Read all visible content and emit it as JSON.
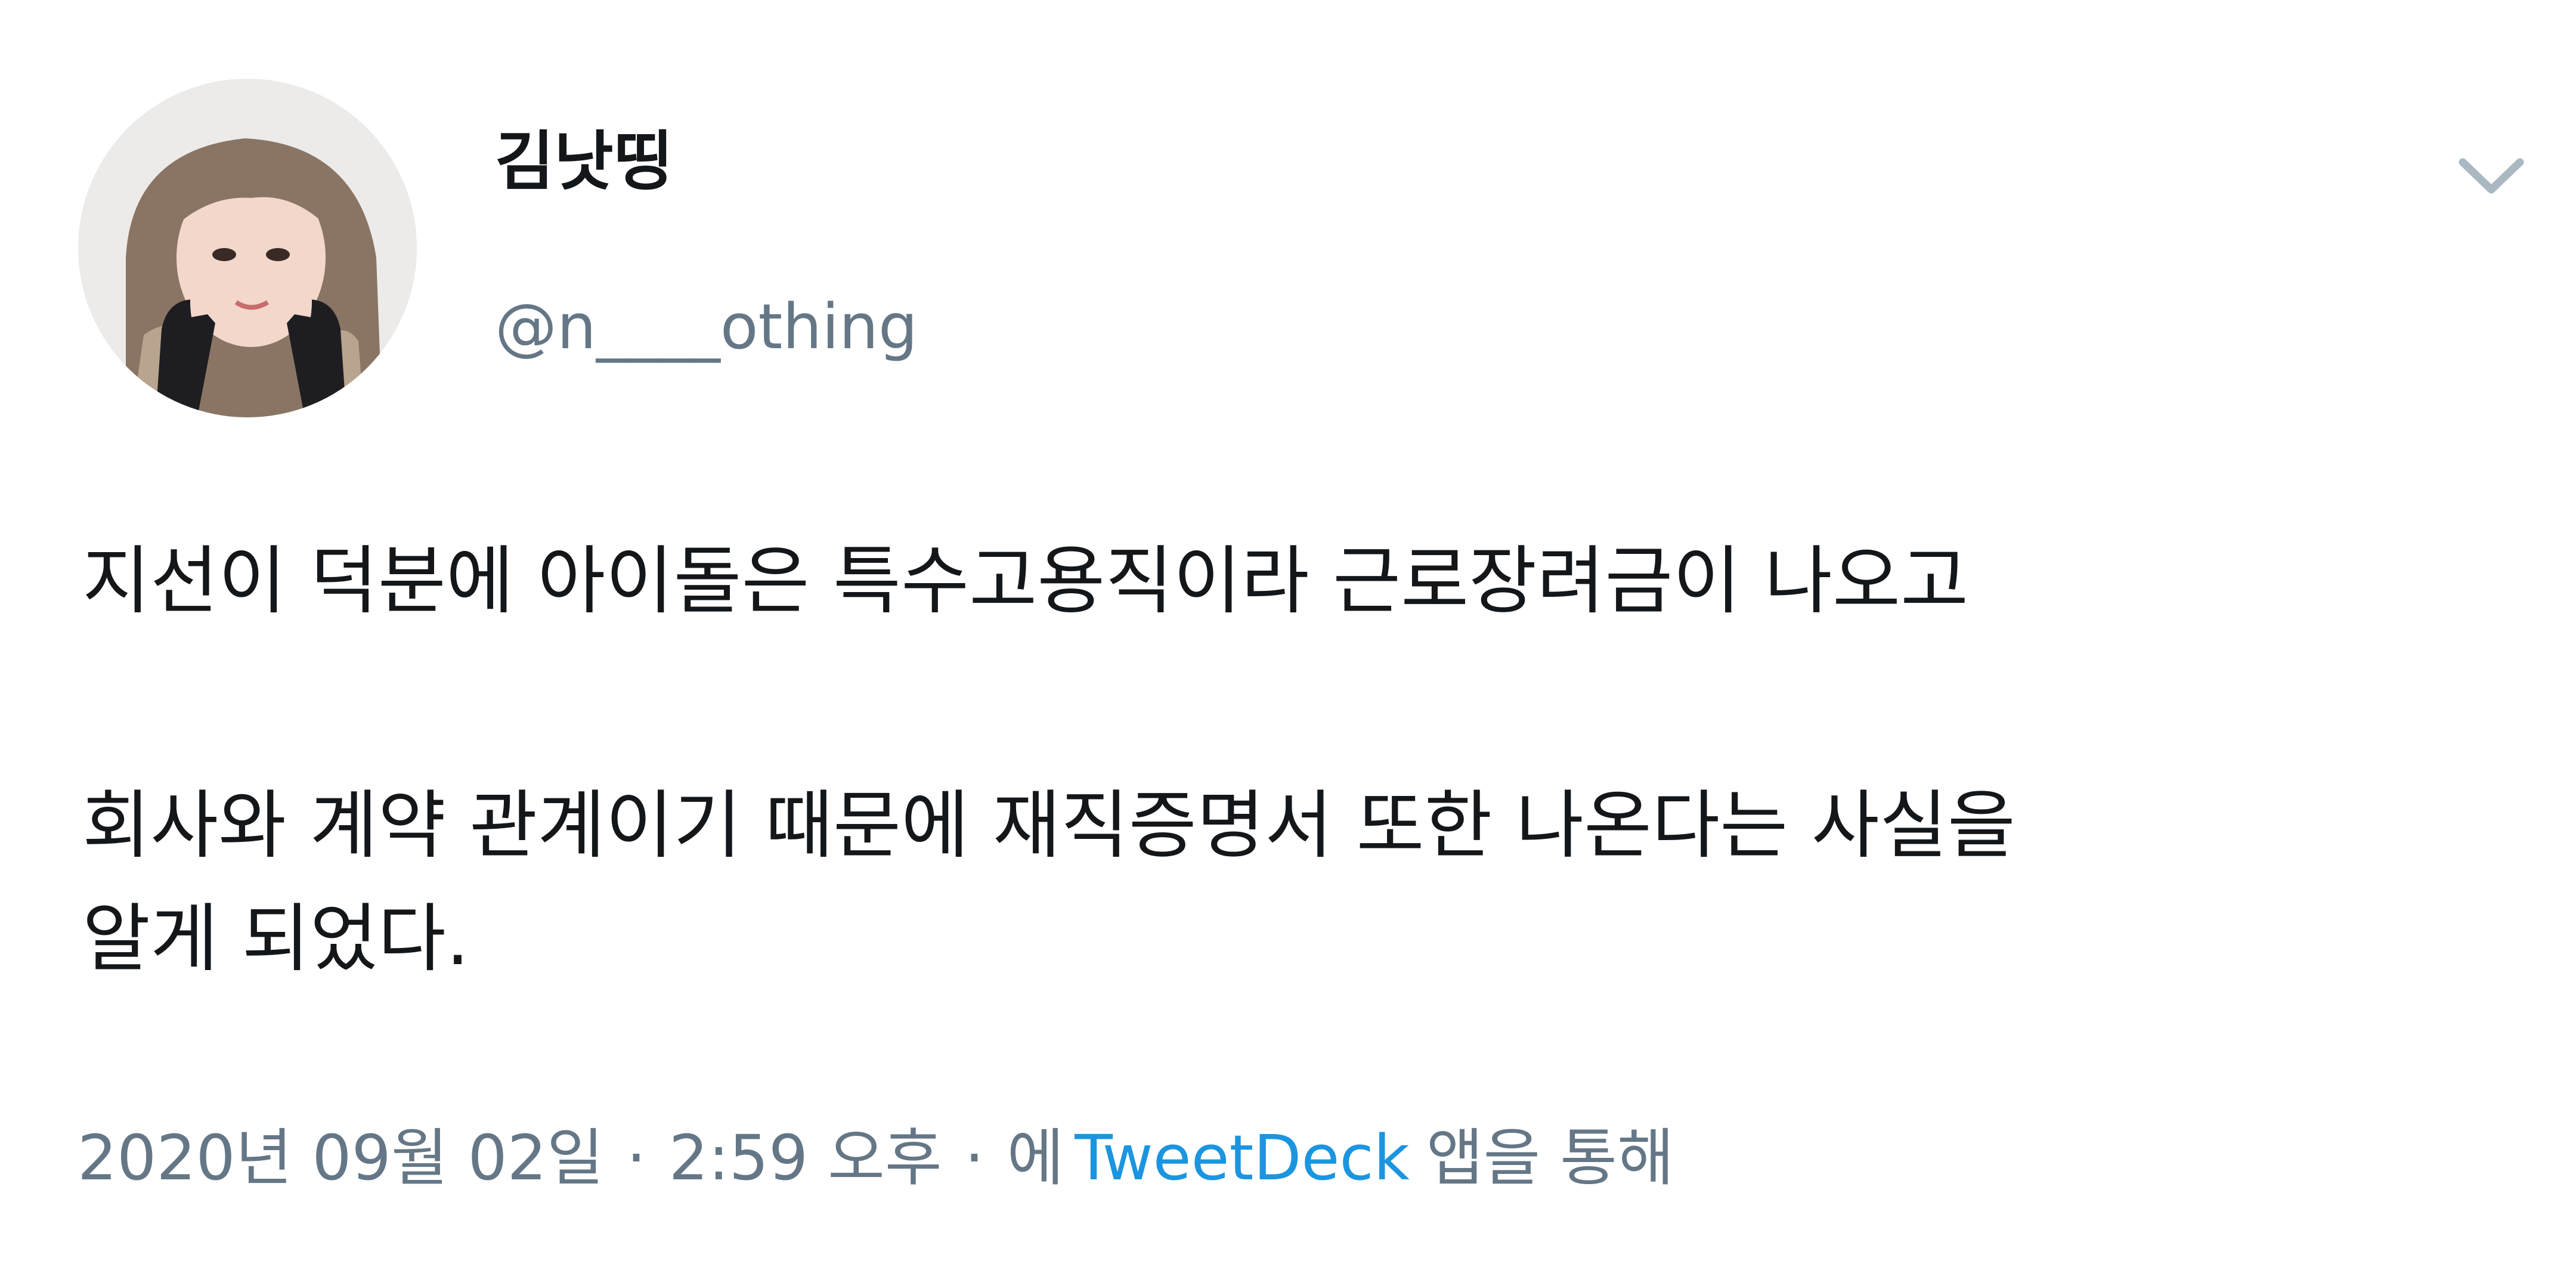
{
  "user": {
    "display_name": "김낫띵",
    "handle": "@n____othing",
    "avatar_icon": "profile-photo"
  },
  "menu": {
    "icon": "chevron-down-icon",
    "color": "#aab8c2"
  },
  "tweet": {
    "paragraph_1": "지선이 덕분에 아이돌은 특수고용직이라 근로장려금이 나오고",
    "paragraph_2_line_1": "회사와 계약 관계이기 때문에 재직증명서 또한 나온다는 사실을",
    "paragraph_2_line_2": "알게 되었다."
  },
  "meta": {
    "date": "2020년 09월 02일",
    "separator": "·",
    "time": "2:59 오후",
    "via_prefix": "에",
    "source": "TweetDeck",
    "via_suffix": "앱을 통해"
  },
  "colors": {
    "text": "#14171a",
    "secondary": "#657786",
    "link": "#1b95e0"
  }
}
